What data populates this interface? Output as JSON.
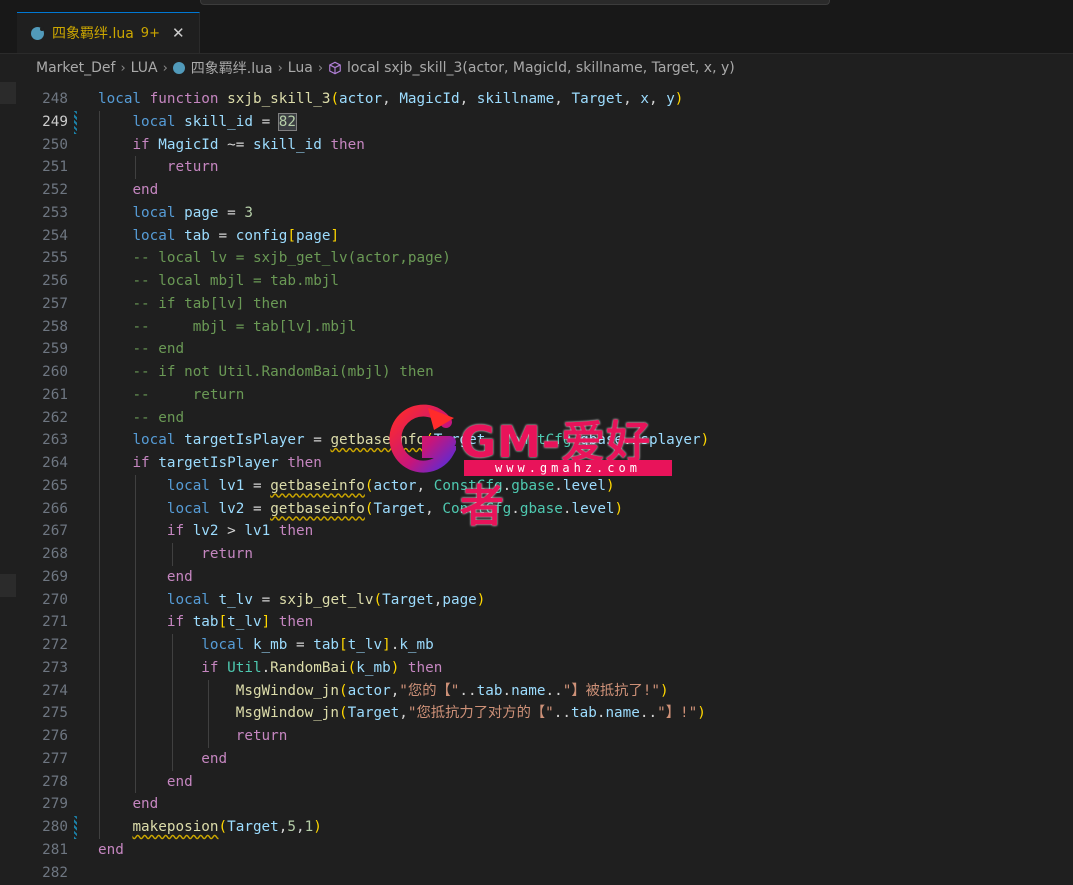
{
  "tab": {
    "title": "四象羁绊.lua",
    "badge": "9+",
    "close": "✕"
  },
  "breadcrumb": {
    "items": [
      "Market_Def",
      "LUA",
      "四象羁绊.lua",
      "Lua",
      "local sxjb_skill_3(actor, MagicId, skillname, Target, x, y)"
    ],
    "separator": "›"
  },
  "editor": {
    "current_line": 249,
    "lines": [
      {
        "n": "248",
        "html": "<span class=\"kw2\">local</span> <span class=\"kw\">function</span> <span class=\"fn\">sxjb_skill_3</span><span class=\"br1\">(</span><span class=\"v\">actor</span>, <span class=\"v\">MagicId</span>, <span class=\"v\">skillname</span>, <span class=\"v\">Target</span>, <span class=\"v\">x</span>, <span class=\"v\">y</span><span class=\"br1\">)</span>"
      },
      {
        "n": "249",
        "html": "    <span class=\"kw2\">local</span> <span class=\"v\">skill_id</span> = <span class=\"num cursor-box\">82</span>"
      },
      {
        "n": "250",
        "html": "    <span class=\"kw\">if</span> <span class=\"v\">MagicId</span> ~= <span class=\"v\">skill_id</span> <span class=\"kw\">then</span>"
      },
      {
        "n": "251",
        "html": "        <span class=\"kw\">return</span>"
      },
      {
        "n": "252",
        "html": "    <span class=\"kw\">end</span>"
      },
      {
        "n": "253",
        "html": "    <span class=\"kw2\">local</span> <span class=\"v\">page</span> = <span class=\"num\">3</span>"
      },
      {
        "n": "254",
        "html": "    <span class=\"kw2\">local</span> <span class=\"v\">tab</span> = <span class=\"v\">config</span><span class=\"br1\">[</span><span class=\"v\">page</span><span class=\"br1\">]</span>"
      },
      {
        "n": "255",
        "html": "    <span class=\"cm\">-- local lv = sxjb_get_lv(actor,page)</span>"
      },
      {
        "n": "256",
        "html": "    <span class=\"cm\">-- local mbjl = tab.mbjl</span>"
      },
      {
        "n": "257",
        "html": "    <span class=\"cm\">-- if tab[lv] then</span>"
      },
      {
        "n": "258",
        "html": "    <span class=\"cm\">--     mbjl = tab[lv].mbjl</span>"
      },
      {
        "n": "259",
        "html": "    <span class=\"cm\">-- end</span>"
      },
      {
        "n": "260",
        "html": "    <span class=\"cm\">-- if not Util.RandomBai(mbjl) then</span>"
      },
      {
        "n": "261",
        "html": "    <span class=\"cm\">--     return</span>"
      },
      {
        "n": "262",
        "html": "    <span class=\"cm\">-- end</span>"
      },
      {
        "n": "263",
        "html": "    <span class=\"kw2\">local</span> <span class=\"v\">targetIsPlayer</span> = <span class=\"fn sq\">getbaseinfo</span><span class=\"br1\">(</span><span class=\"v\">Target</span>, <span class=\"prop\">ConstCfg</span>.<span class=\"v\">gbase</span>.<span class=\"v\">isplayer</span><span class=\"br1\">)</span>"
      },
      {
        "n": "264",
        "html": "    <span class=\"kw\">if</span> <span class=\"v\">targetIsPlayer</span> <span class=\"kw\">then</span>"
      },
      {
        "n": "265",
        "html": "        <span class=\"kw2\">local</span> <span class=\"v\">lv1</span> = <span class=\"fn sq\">getbaseinfo</span><span class=\"br1\">(</span><span class=\"v\">actor</span>, <span class=\"prop\">ConstCfg</span>.<span class=\"prop\">gbase</span>.<span class=\"v\">level</span><span class=\"br1\">)</span>"
      },
      {
        "n": "266",
        "html": "        <span class=\"kw2\">local</span> <span class=\"v\">lv2</span> = <span class=\"fn sq\">getbaseinfo</span><span class=\"br1\">(</span><span class=\"v\">Target</span>, <span class=\"prop\">ConstCfg</span>.<span class=\"prop\">gbase</span>.<span class=\"v\">level</span><span class=\"br1\">)</span>"
      },
      {
        "n": "267",
        "html": "        <span class=\"kw\">if</span> <span class=\"v\">lv2</span> &gt; <span class=\"v\">lv1</span> <span class=\"kw\">then</span>"
      },
      {
        "n": "268",
        "html": "            <span class=\"kw\">return</span>"
      },
      {
        "n": "269",
        "html": "        <span class=\"kw\">end</span>"
      },
      {
        "n": "270",
        "html": "        <span class=\"kw2\">local</span> <span class=\"v\">t_lv</span> = <span class=\"fn\">sxjb_get_lv</span><span class=\"br1\">(</span><span class=\"v\">Target</span>,<span class=\"v\">page</span><span class=\"br1\">)</span>"
      },
      {
        "n": "271",
        "html": "        <span class=\"kw\">if</span> <span class=\"v\">tab</span><span class=\"br1\">[</span><span class=\"v\">t_lv</span><span class=\"br1\">]</span> <span class=\"kw\">then</span>"
      },
      {
        "n": "272",
        "html": "            <span class=\"kw2\">local</span> <span class=\"v\">k_mb</span> = <span class=\"v\">tab</span><span class=\"br1\">[</span><span class=\"v\">t_lv</span><span class=\"br1\">]</span>.<span class=\"v\">k_mb</span>"
      },
      {
        "n": "273",
        "html": "            <span class=\"kw\">if</span> <span class=\"prop\">Util</span>.<span class=\"fn\">RandomBai</span><span class=\"br1\">(</span><span class=\"v\">k_mb</span><span class=\"br1\">)</span> <span class=\"kw\">then</span>"
      },
      {
        "n": "274",
        "html": "                <span class=\"fn\">MsgWindow_jn</span><span class=\"br1\">(</span><span class=\"v\">actor</span>,<span class=\"str\">\"您的【\"</span>..<span class=\"v\">tab</span>.<span class=\"v\">name</span>..<span class=\"str\">\"】被抵抗了!\"</span><span class=\"br1\">)</span>"
      },
      {
        "n": "275",
        "html": "                <span class=\"fn\">MsgWindow_jn</span><span class=\"br1\">(</span><span class=\"v\">Target</span>,<span class=\"str\">\"您抵抗力了对方的【\"</span>..<span class=\"v\">tab</span>.<span class=\"v\">name</span>..<span class=\"str\">\"】!\"</span><span class=\"br1\">)</span>"
      },
      {
        "n": "276",
        "html": "                <span class=\"kw\">return</span>"
      },
      {
        "n": "277",
        "html": "            <span class=\"kw\">end</span>"
      },
      {
        "n": "278",
        "html": "        <span class=\"kw\">end</span>"
      },
      {
        "n": "279",
        "html": "    <span class=\"kw\">end</span>"
      },
      {
        "n": "280",
        "html": "    <span class=\"fn sq\">makeposion</span><span class=\"br1\">(</span><span class=\"v\">Target</span>,<span class=\"num\">5</span>,<span class=\"num\">1</span><span class=\"br1\">)</span>"
      },
      {
        "n": "281",
        "html": "<span class=\"kw\">end</span>"
      },
      {
        "n": "282",
        "html": ""
      }
    ]
  },
  "watermark": {
    "brand": "GM-爱好者",
    "url": "www.gmahz.com"
  }
}
